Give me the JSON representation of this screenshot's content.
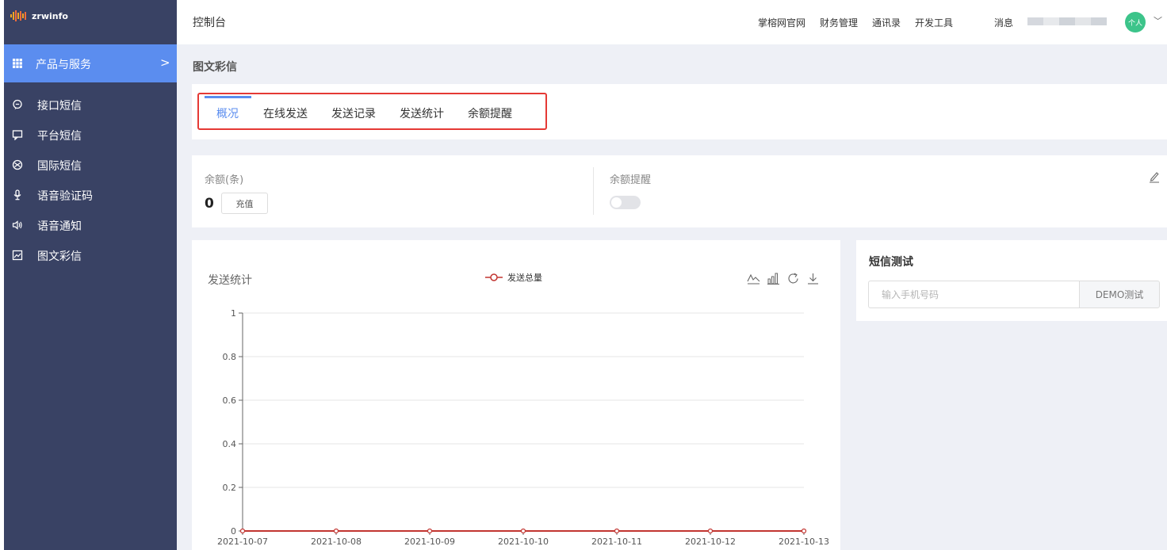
{
  "brand": {
    "name": "zrwinfo",
    "accent": "#5b8def",
    "sidebar_bg": "#394264"
  },
  "sidebar": {
    "section": {
      "label": "产品与服务",
      "icon": "grid-icon",
      "chevron": ">"
    },
    "items": [
      {
        "label": "接口短信",
        "icon": "chat-bubble-icon"
      },
      {
        "label": "平台短信",
        "icon": "message-square-icon"
      },
      {
        "label": "国际短信",
        "icon": "globe-icon"
      },
      {
        "label": "语音验证码",
        "icon": "microphone-icon"
      },
      {
        "label": "语音通知",
        "icon": "speaker-icon"
      },
      {
        "label": "图文彩信",
        "icon": "image-icon"
      }
    ]
  },
  "topbar": {
    "title": "控制台",
    "links": [
      "掌榕网官网",
      "财务管理",
      "通讯录",
      "开发工具"
    ],
    "messages": "消息",
    "avatar": "个人",
    "caret": "﹀"
  },
  "page": {
    "title": "图文彩信"
  },
  "tabs": [
    {
      "label": "概况",
      "active": true
    },
    {
      "label": "在线发送",
      "active": false
    },
    {
      "label": "发送记录",
      "active": false
    },
    {
      "label": "发送统计",
      "active": false
    },
    {
      "label": "余额提醒",
      "active": false
    }
  ],
  "balance": {
    "label": "余额(条)",
    "count": "0",
    "recharge_label": "充值",
    "reminder_label": "余额提醒",
    "reminder_enabled": false
  },
  "sms_test": {
    "title": "短信测试",
    "placeholder": "输入手机号码",
    "button_label": "DEMO测试"
  },
  "chart_data": {
    "type": "line",
    "title": "发送统计",
    "categories": [
      "2021-10-07",
      "2021-10-08",
      "2021-10-09",
      "2021-10-10",
      "2021-10-11",
      "2021-10-12",
      "2021-10-13"
    ],
    "series": [
      {
        "name": "发送总量",
        "values": [
          0,
          0,
          0,
          0,
          0,
          0,
          0
        ],
        "color": "#c23531"
      }
    ],
    "ylim": [
      0,
      1
    ],
    "yticks": [
      0,
      0.2,
      0.4,
      0.6,
      0.8,
      1
    ],
    "ytick_labels": [
      "0",
      "0.2",
      "0.4",
      "0.6",
      "0.8",
      "1"
    ],
    "grid": true,
    "legend": "top-center"
  }
}
